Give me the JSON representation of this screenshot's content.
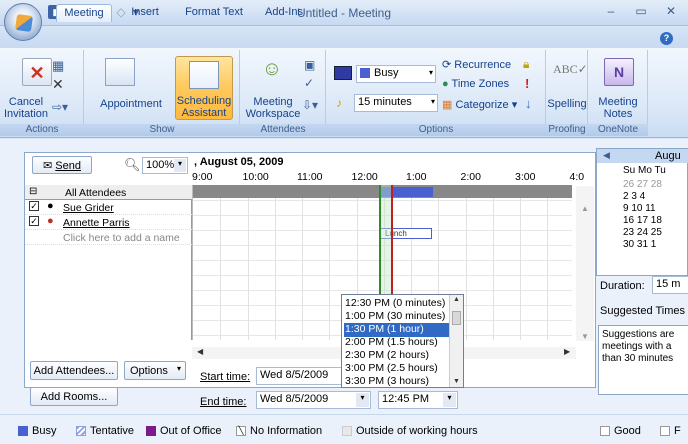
{
  "window": {
    "title": "Untitled - Meeting"
  },
  "quick_access": [
    "save-icon",
    "undo-icon",
    "redo-icon",
    "up-arrow-icon",
    "down-arrow-icon",
    "qat-dropdown-icon"
  ],
  "tabs": [
    "Meeting",
    "Insert",
    "Format Text",
    "Add-Ins"
  ],
  "ribbon": {
    "actions": {
      "cancel_label": "Cancel\nInvitation",
      "group": "Actions"
    },
    "show": {
      "appointment": "Appointment",
      "scheduling": "Scheduling\nAssistant",
      "group": "Show"
    },
    "attendees": {
      "workspace": "Meeting\nWorkspace",
      "group": "Attendees"
    },
    "options": {
      "show_as": "Busy",
      "reminder": "15 minutes",
      "recurrence": "Recurrence",
      "time_zones": "Time Zones",
      "categorize": "Categorize",
      "group": "Options"
    },
    "proofing": {
      "spelling": "Spelling",
      "group": "Proofing"
    },
    "onenote": {
      "notes": "Meeting\nNotes",
      "group": "OneNote"
    }
  },
  "scheduler": {
    "send": "Send",
    "zoom": "100%",
    "date_header": ", August 05, 2009",
    "times": [
      "9:00",
      "10:00",
      "11:00",
      "12:00",
      "1:00",
      "2:00",
      "3:00",
      "4:0"
    ],
    "all_attendees": "All Attendees",
    "attendees": [
      {
        "name": "Sue Grider",
        "checked": true
      },
      {
        "name": "Annette Parris",
        "checked": true
      }
    ],
    "add_name_placeholder": "Click here to add a name",
    "lunch_label": "Lunch",
    "add_attendees": "Add Attendees...",
    "options": "Options",
    "add_rooms": "Add Rooms...",
    "start_time_label": "Start time:",
    "end_time_label": "End time:",
    "start_date": "Wed 8/5/2009",
    "end_date": "Wed 8/5/2009",
    "end_time": "12:45 PM",
    "dropdown_options": [
      "12:30 PM (0 minutes)",
      "1:00 PM (30 minutes)",
      "1:30 PM (1 hour)",
      "2:00 PM (1.5 hours)",
      "2:30 PM (2 hours)",
      "3:00 PM (2.5 hours)",
      "3:30 PM (3 hours)"
    ],
    "dropdown_selected": "1:30 PM (1 hour)"
  },
  "calendar": {
    "month": "Augu",
    "days_header": "Su Mo Tu",
    "weeks": [
      "26 27 28",
      "2 3 4",
      "9 10 11",
      "16 17 18",
      "23 24 25",
      "30 31 1"
    ]
  },
  "right": {
    "duration_label": "Duration:",
    "duration": "15 m",
    "suggested": "Suggested Times",
    "suggest_text": "Suggestions are\nmeetings with a\nthan 30 minutes"
  },
  "legend": {
    "busy": "Busy",
    "tentative": "Tentative",
    "out_of_office": "Out of Office",
    "no_info": "No Information",
    "outside": "Outside of working hours",
    "good": "Good",
    "f": "F"
  },
  "colors": {
    "busy": "#4a5fd0",
    "tentative": "#8fa0e0",
    "out_of_office": "#7b1a8a",
    "ribbon_accent": "#ffc85c"
  }
}
